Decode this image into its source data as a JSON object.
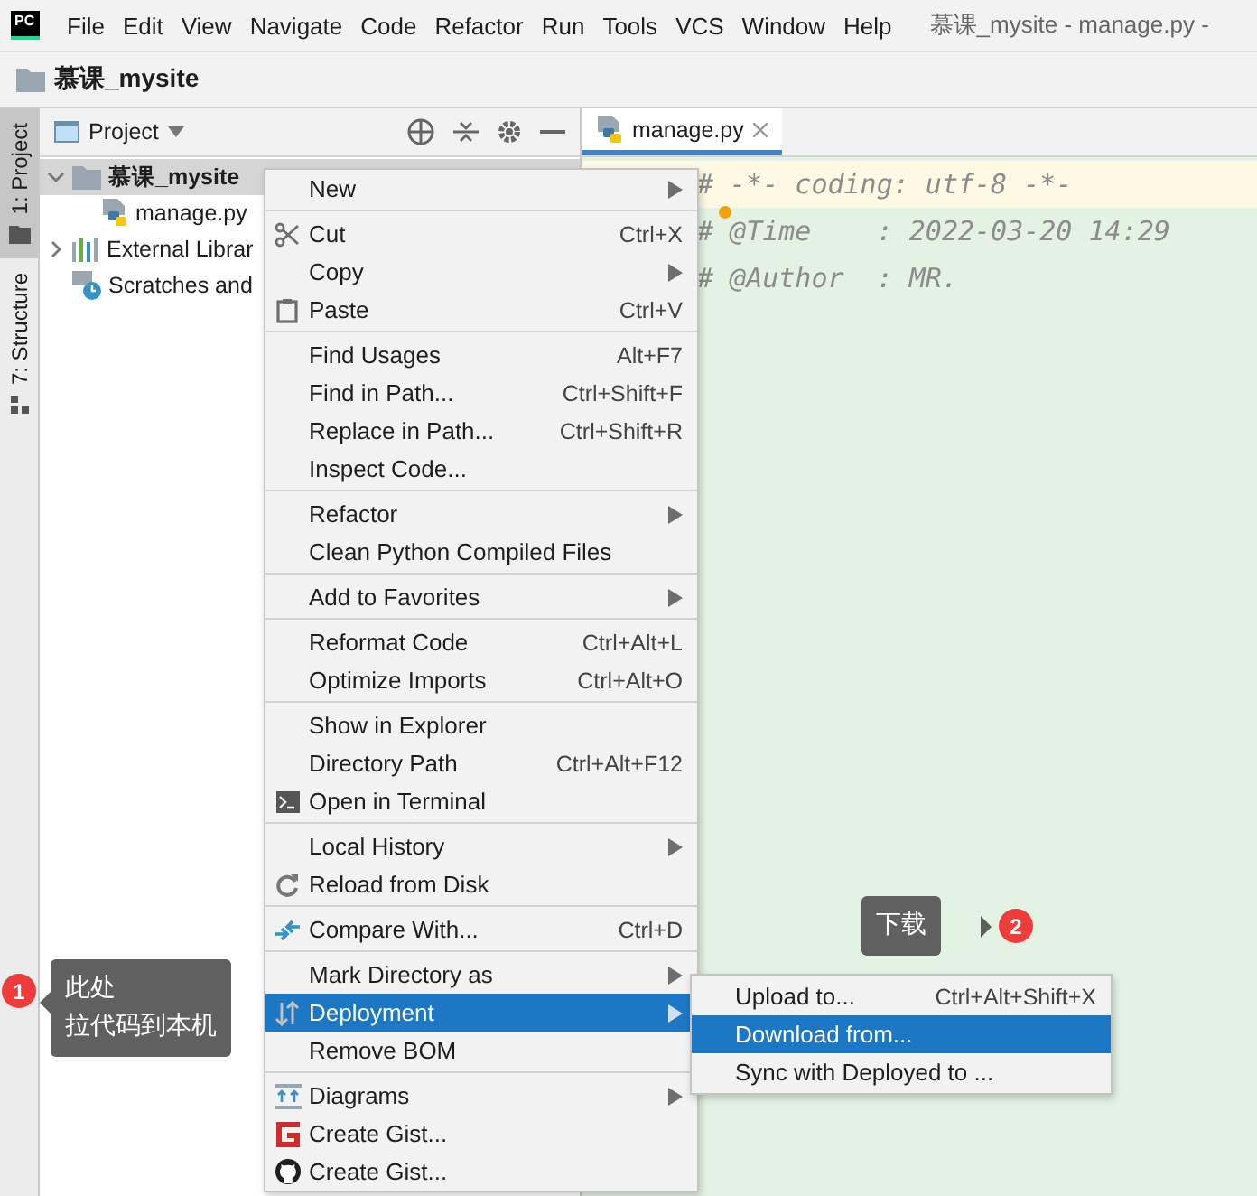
{
  "menu_bar": {
    "logo": "PC",
    "items": [
      "File",
      "Edit",
      "View",
      "Navigate",
      "Code",
      "Refactor",
      "Run",
      "Tools",
      "VCS",
      "Window",
      "Help"
    ],
    "title": "慕课_mysite - manage.py -"
  },
  "nav_bar": {
    "path": "慕课_mysite"
  },
  "tool_strip": [
    {
      "label": "1: Project",
      "selected": true
    },
    {
      "label": "7: Structure",
      "selected": false
    }
  ],
  "project_panel": {
    "title": "Project",
    "tree": [
      {
        "label": "慕课_mysite",
        "kind": "folder",
        "expanded": true,
        "children": [
          {
            "label": "manage.py",
            "kind": "python"
          }
        ]
      },
      {
        "label": "External Librar",
        "kind": "libraries",
        "expanded": false
      },
      {
        "label": "Scratches and",
        "kind": "scratches"
      }
    ]
  },
  "editor": {
    "tab": "manage.py",
    "lines": [
      {
        "text": "# -*- coding: utf-8 -*-",
        "current": true,
        "bulb": false
      },
      {
        "text": "# @Time    : 2022-03-20 14:29",
        "current": false,
        "bulb": true
      },
      {
        "text": "# @Author  : MR.",
        "current": false,
        "bulb": false
      }
    ]
  },
  "context_menu": {
    "groups": [
      [
        {
          "label": "New",
          "submenu": true,
          "selected": false
        }
      ],
      [
        {
          "label": "Cut",
          "shortcut": "Ctrl+X",
          "kind": "scissors",
          "selected": false
        },
        {
          "label": "Copy",
          "submenu": true,
          "selected": false
        },
        {
          "label": "Paste",
          "shortcut": "Ctrl+V",
          "kind": "clipboard",
          "selected": false
        }
      ],
      [
        {
          "label": "Find Usages",
          "shortcut": "Alt+F7",
          "selected": false
        },
        {
          "label": "Find in Path...",
          "shortcut": "Ctrl+Shift+F",
          "selected": false
        },
        {
          "label": "Replace in Path...",
          "shortcut": "Ctrl+Shift+R",
          "selected": false
        },
        {
          "label": "Inspect Code...",
          "selected": false
        }
      ],
      [
        {
          "label": "Refactor",
          "submenu": true,
          "selected": false
        },
        {
          "label": "Clean Python Compiled Files",
          "selected": false
        }
      ],
      [
        {
          "label": "Add to Favorites",
          "submenu": true,
          "selected": false
        }
      ],
      [
        {
          "label": "Reformat Code",
          "shortcut": "Ctrl+Alt+L",
          "selected": false
        },
        {
          "label": "Optimize Imports",
          "shortcut": "Ctrl+Alt+O",
          "selected": false
        }
      ],
      [
        {
          "label": "Show in Explorer",
          "selected": false
        },
        {
          "label": "Directory Path",
          "shortcut": "Ctrl+Alt+F12",
          "selected": false
        },
        {
          "label": "Open in Terminal",
          "kind": "terminal",
          "selected": false
        }
      ],
      [
        {
          "label": "Local History",
          "submenu": true,
          "selected": false
        },
        {
          "label": "Reload from Disk",
          "kind": "reload",
          "selected": false
        }
      ],
      [
        {
          "label": "Compare With...",
          "shortcut": "Ctrl+D",
          "kind": "compare",
          "selected": false
        }
      ],
      [
        {
          "label": "Mark Directory as",
          "submenu": true,
          "selected": false
        },
        {
          "label": "Deployment",
          "submenu": true,
          "kind": "deploy",
          "selected": true
        },
        {
          "label": "Remove BOM",
          "selected": false
        }
      ],
      [
        {
          "label": "Diagrams",
          "submenu": true,
          "kind": "diagram",
          "selected": false
        },
        {
          "label": "Create Gist...",
          "kind": "gist",
          "selected": false
        },
        {
          "label": "Create Gist...",
          "kind": "github",
          "selected": false
        }
      ]
    ]
  },
  "submenu": [
    {
      "label": "Upload to...",
      "shortcut": "Ctrl+Alt+Shift+X",
      "selected": false
    },
    {
      "label": "Download from...",
      "selected": true
    },
    {
      "label": "Sync with Deployed to ...",
      "selected": false
    }
  ],
  "callouts": [
    {
      "number": "1",
      "lines": [
        "此处",
        "拉代码到本机"
      ]
    },
    {
      "number": "2",
      "lines": [
        "下载"
      ]
    }
  ]
}
